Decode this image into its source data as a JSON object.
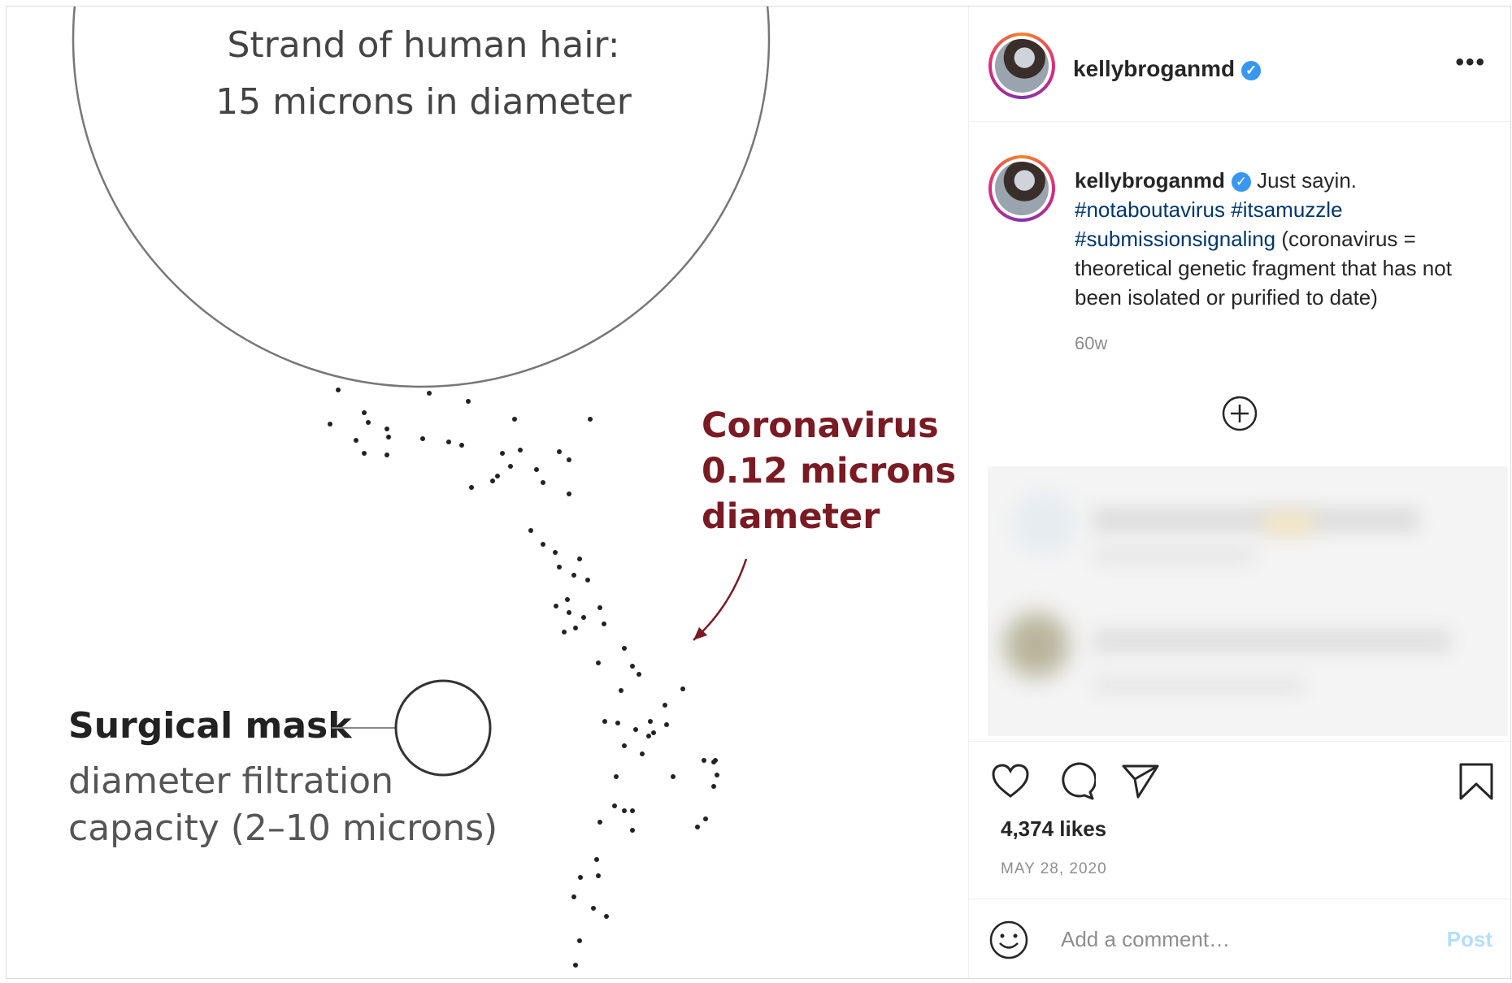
{
  "media": {
    "hair_line1": "Strand of human hair:",
    "hair_line2": "15 microns in diameter",
    "virus_line1": "Coronavirus",
    "virus_line2": "0.12 microns",
    "virus_line3": "diameter",
    "mask_title": "Surgical mask",
    "mask_line1": "diameter filtration",
    "mask_line2": "capacity (2–10 microns)"
  },
  "header": {
    "username": "kellybroganmd",
    "more_label": "•••"
  },
  "caption": {
    "username": "kellybroganmd",
    "text_intro": "Just sayin.",
    "tag1": "#notaboutavirus",
    "tag2": "#itsamuzzle",
    "tag3": "#submissionsignaling",
    "text_rest": "(coronavirus = theoretical genetic fragment that has not been isolated or purified to date)",
    "age": "60w"
  },
  "actions": {
    "likes": "4,374 likes",
    "date": "MAY 28, 2020"
  },
  "comment": {
    "placeholder": "Add a comment…",
    "post_label": "Post"
  },
  "colors": {
    "verified": "#3897f0",
    "hashtag": "#00376b",
    "virus_label": "#7a1a22",
    "post_button_disabled": "#b2dffc"
  },
  "icons": [
    "verified-badge-icon",
    "more-options-icon",
    "add-plus-icon",
    "heart-icon",
    "comment-icon",
    "share-icon",
    "bookmark-icon",
    "emoji-icon"
  ]
}
